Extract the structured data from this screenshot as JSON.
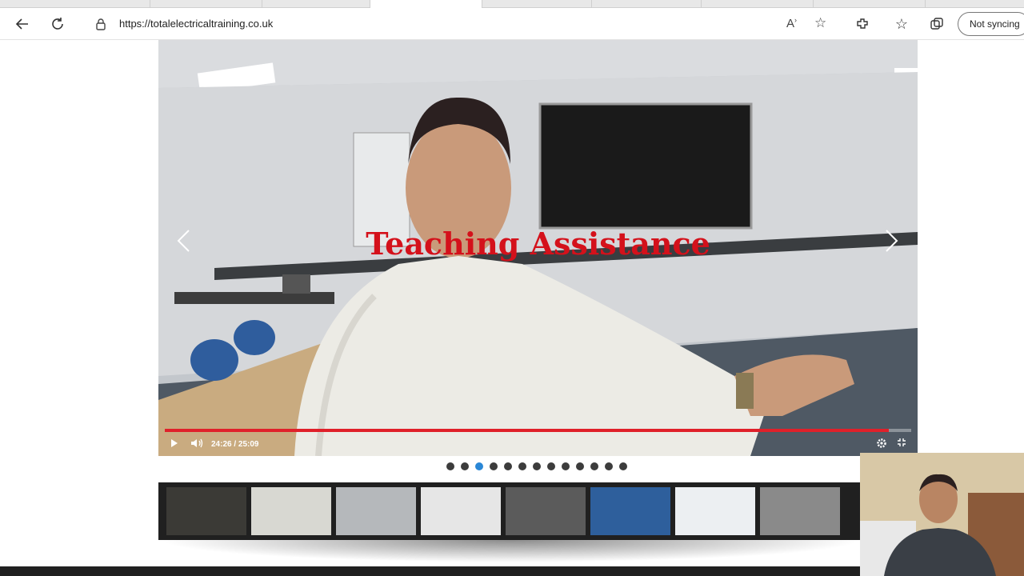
{
  "browser": {
    "url": "https://totalelectricaltraining.co.uk",
    "sync_label": "Not syncing"
  },
  "video": {
    "overlay_title": "Teaching Assistance",
    "time": "24:26 / 25:09",
    "progress": 0.97
  },
  "carousel": {
    "dot_count": 13,
    "active_dot": 2
  },
  "thumbnails": [
    {
      "label": "thumb-1"
    },
    {
      "label": "thumb-2"
    },
    {
      "label": "thumb-3"
    },
    {
      "label": "thumb-4"
    },
    {
      "label": "thumb-5"
    },
    {
      "label": "thumb-6"
    },
    {
      "label": "thumb-7"
    },
    {
      "label": "thumb-8"
    }
  ],
  "colors": {
    "title_red": "#d4111b",
    "progress_red": "#e0202a",
    "dot_active": "#2a87d6"
  }
}
